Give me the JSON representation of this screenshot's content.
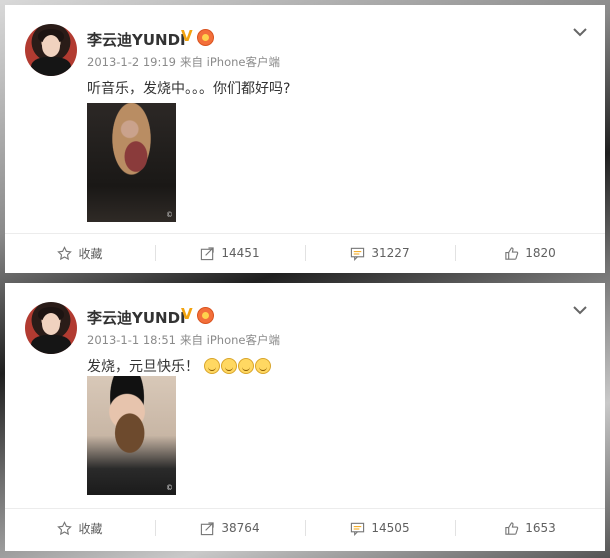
{
  "posts": [
    {
      "user": "李云迪YUNDI",
      "time": "2013-1-2 19:19",
      "source": "来自 iPhone客户端",
      "text": "听音乐，发烧中。。。你们都好吗?",
      "photo_watermark": "©",
      "actions": {
        "favorite": "收藏",
        "repost": "14451",
        "comment": "31227",
        "like": "1820"
      }
    },
    {
      "user": "李云迪YUNDI",
      "time": "2013-1-1 18:51",
      "source": "来自 iPhone客户端",
      "text": "发烧，元旦快乐！",
      "photo_watermark": "©",
      "actions": {
        "favorite": "收藏",
        "repost": "38764",
        "comment": "14505",
        "like": "1653"
      }
    }
  ],
  "colors": {
    "badge_v": "#f2a30f",
    "text": "#333333",
    "meta": "#8a8a8a"
  },
  "icons": [
    "chevron-down-icon",
    "star-icon",
    "share-icon",
    "comment-icon",
    "thumbs-up-icon",
    "verified-v-icon",
    "medal-icon",
    "emoji-icon"
  ]
}
